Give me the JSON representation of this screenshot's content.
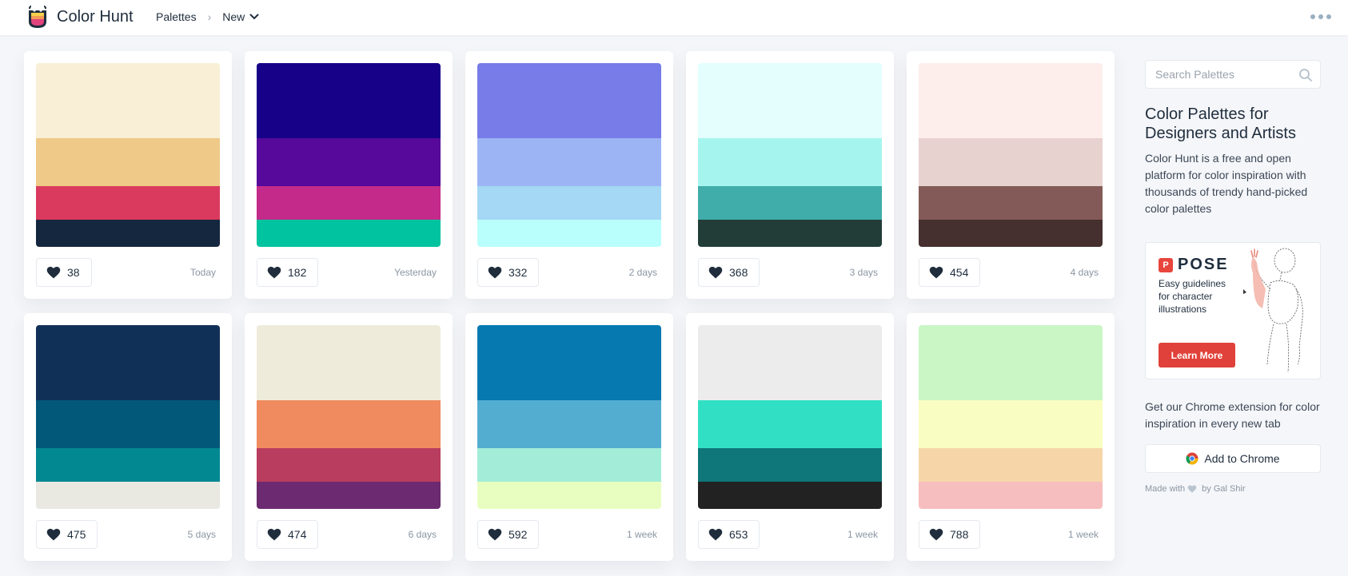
{
  "header": {
    "brand": "Color Hunt",
    "breadcrumb": {
      "root": "Palettes",
      "current": "New"
    }
  },
  "palettes": [
    {
      "colors": [
        "#F9EFD6",
        "#EEC987",
        "#DA3A5E",
        "#15263F"
      ],
      "likes": "38",
      "date": "Today"
    },
    {
      "colors": [
        "#160188",
        "#56099A",
        "#C32A8A",
        "#02C39F"
      ],
      "likes": "182",
      "date": "Yesterday"
    },
    {
      "colors": [
        "#777CE8",
        "#9CB4F4",
        "#A4D8F4",
        "#B9FFFB"
      ],
      "likes": "332",
      "date": "2 days"
    },
    {
      "colors": [
        "#E3FEFD",
        "#A6F4EE",
        "#40ADAA",
        "#223D38"
      ],
      "likes": "368",
      "date": "3 days"
    },
    {
      "colors": [
        "#FDEEEC",
        "#E8D2D0",
        "#835A57",
        "#452F2F"
      ],
      "likes": "454",
      "date": "4 days"
    },
    {
      "colors": [
        "#113057",
        "#025879",
        "#028891",
        "#E9E8E1"
      ],
      "likes": "475",
      "date": "5 days"
    },
    {
      "colors": [
        "#EEEBDB",
        "#EF8B5F",
        "#B93D5E",
        "#6C2A70"
      ],
      "likes": "474",
      "date": "6 days"
    },
    {
      "colors": [
        "#0579B0",
        "#53ADD1",
        "#A3EDD8",
        "#E8FEC0"
      ],
      "likes": "592",
      "date": "1 week"
    },
    {
      "colors": [
        "#ECECEC",
        "#31E0C4",
        "#0F7679",
        "#222222"
      ],
      "likes": "653",
      "date": "1 week"
    },
    {
      "colors": [
        "#C9F6C4",
        "#F9FDC1",
        "#F6D6A9",
        "#F6BEBF"
      ],
      "likes": "788",
      "date": "1 week"
    }
  ],
  "sidebar": {
    "search_placeholder": "Search Palettes",
    "title": "Color Palettes for Designers and Artists",
    "description": "Color Hunt is a free and open platform for color inspiration with thousands of trendy hand-picked color palettes",
    "ad": {
      "brand": "POSE",
      "mark": "P",
      "text": "Easy guidelines for character illustrations",
      "cta": "Learn More"
    },
    "extension_text": "Get our Chrome extension for color inspiration in every new tab",
    "chrome_button": "Add to Chrome",
    "made_with": "Made with",
    "made_by": "by Gal Shir"
  },
  "colors": {
    "heart": "#1f2d3d",
    "accent_red": "#e0413a",
    "muted_heart": "#b8c4cf"
  }
}
